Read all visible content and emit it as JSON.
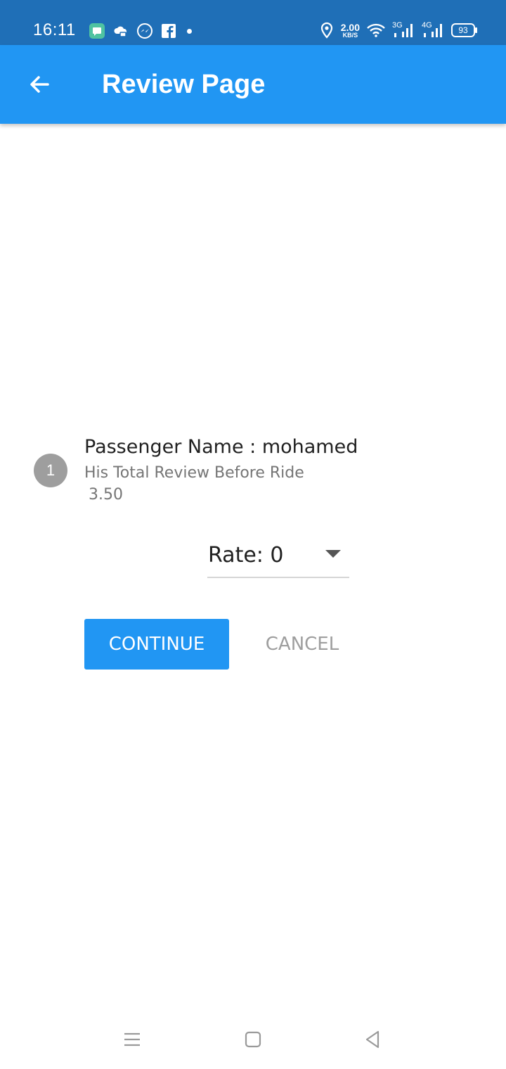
{
  "status_bar": {
    "time": "16:11",
    "left_icons": [
      "messages-icon",
      "cloud-icon",
      "messenger-icon",
      "facebook-icon",
      "dot-icon"
    ],
    "net_speed_value": "2.00",
    "net_speed_unit": "KB/S",
    "network_1": "3G",
    "network_2": "4G",
    "battery": "93"
  },
  "app_bar": {
    "title": "Review Page",
    "back_icon": "arrow-left-icon"
  },
  "passenger": {
    "index": "1",
    "name_line": "Passenger Name : mohamed",
    "review_label": "His Total Review Before Ride",
    "review_value": "3.50"
  },
  "rate": {
    "selected": "Rate: 0"
  },
  "actions": {
    "continue_label": "CONTINUE",
    "cancel_label": "CANCEL"
  },
  "colors": {
    "status_bar": "#1f6fb7",
    "app_bar": "#2196f3",
    "primary_button": "#2196f3",
    "avatar": "#9e9e9e"
  },
  "nav_bar": {
    "icons": [
      "menu-icon",
      "home-icon",
      "back-triangle-icon"
    ]
  }
}
